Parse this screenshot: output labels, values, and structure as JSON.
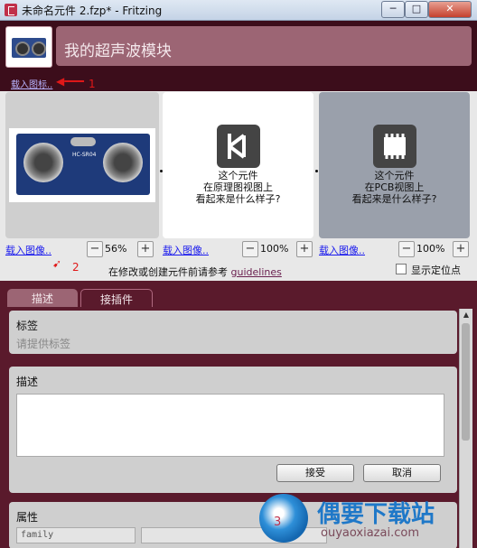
{
  "window": {
    "title": "未命名元件 2.fzp* - Fritzing",
    "buttons": [
      "─",
      "□",
      "✕"
    ]
  },
  "header": {
    "part_name": "我的超声波模块",
    "load_icon_link": "载入图标..",
    "annotation_1": "1"
  },
  "views": {
    "breadboard": {
      "load_link": "载入图像..",
      "zoom": "56%",
      "board_text": "HC-SR04",
      "annotation": "2"
    },
    "schematic": {
      "load_link": "载入图像..",
      "zoom": "100%",
      "line1": "这个元件",
      "line2": "在原理图视图上",
      "line3": "看起来是什么样子?"
    },
    "pcb": {
      "load_link": "载入图像..",
      "zoom": "100%",
      "line1": "这个元件",
      "line2": "在PCB视图上",
      "line3": "看起来是什么样子?"
    },
    "zoom_minus": "−",
    "zoom_plus": "+",
    "guideline_text": "在修改或创建元件前请参考 ",
    "guideline_link": "guidelines",
    "show_anchor_label": "显示定位点"
  },
  "tabs": [
    "描述",
    "接插件"
  ],
  "sections": {
    "tags": {
      "label": "标签",
      "placeholder": "请提供标签"
    },
    "description": {
      "label": "描述",
      "accept": "接受",
      "cancel": "取消"
    },
    "properties": {
      "label": "属性",
      "first_field": "family",
      "annotation": "3"
    }
  },
  "watermark": {
    "title": "偶要下载站",
    "url": "ouyaoxiazai.com"
  },
  "colors": {
    "header_bg": "#3c0d1b",
    "name_box": "#9c6574",
    "panel_bg": "#5a1a2c",
    "link": "#1a1aee"
  }
}
